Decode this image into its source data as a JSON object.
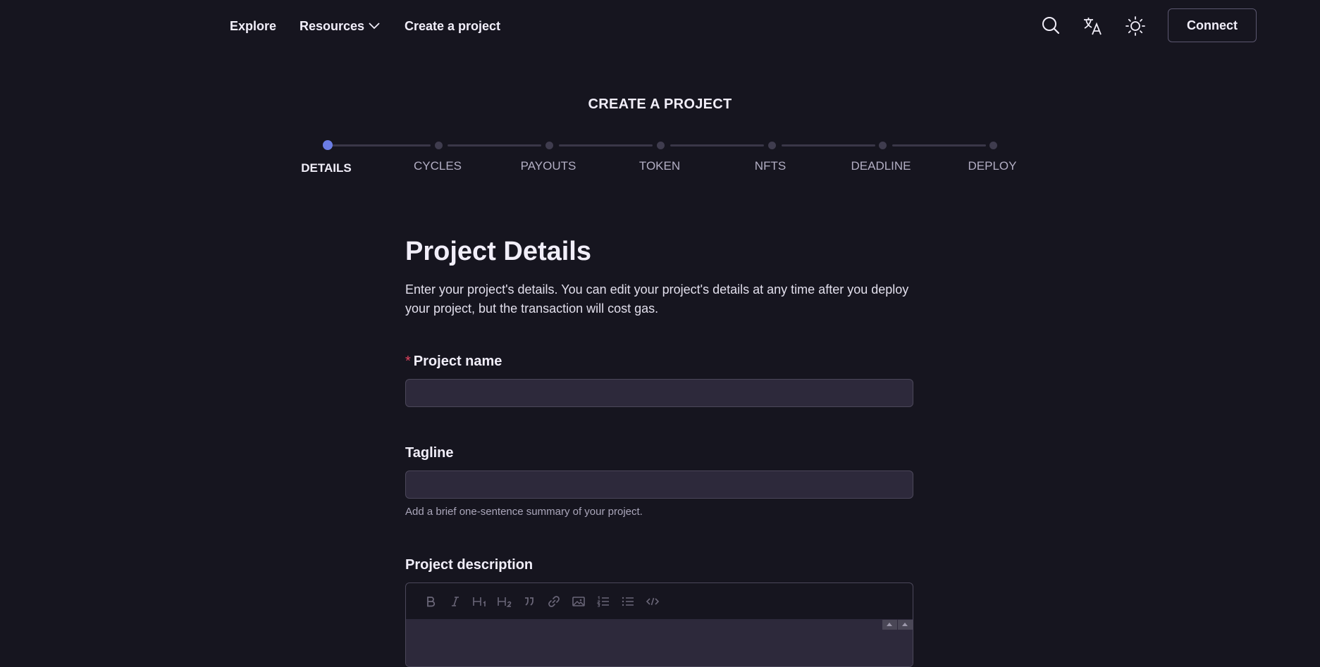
{
  "nav": {
    "explore": "Explore",
    "resources": "Resources",
    "create_project": "Create a project",
    "connect": "Connect",
    "icons": [
      "search-icon",
      "translate-icon",
      "sun-icon"
    ]
  },
  "page": {
    "heading": "CREATE A PROJECT"
  },
  "steps": [
    {
      "label": "DETAILS",
      "active": true
    },
    {
      "label": "CYCLES",
      "active": false
    },
    {
      "label": "PAYOUTS",
      "active": false
    },
    {
      "label": "TOKEN",
      "active": false
    },
    {
      "label": "NFTS",
      "active": false
    },
    {
      "label": "DEADLINE",
      "active": false
    },
    {
      "label": "DEPLOY",
      "active": false
    }
  ],
  "form": {
    "title": "Project Details",
    "description": "Enter your project's details. You can edit your project's details at any time after you deploy your project, but the transaction will cost gas.",
    "project_name": {
      "required_mark": "*",
      "label": "Project name",
      "value": "",
      "placeholder": ""
    },
    "tagline": {
      "label": "Tagline",
      "value": "",
      "placeholder": "",
      "help": "Add a brief one-sentence summary of your project."
    },
    "project_description": {
      "label": "Project description",
      "toolbar": [
        "bold-icon",
        "italic-icon",
        "heading1-icon",
        "heading2-icon",
        "quote-icon",
        "link-icon",
        "image-icon",
        "ordered-list-icon",
        "unordered-list-icon",
        "code-icon"
      ]
    }
  },
  "colors": {
    "background": "#16151f",
    "accent": "#6b7de5",
    "required": "#e1435e",
    "input_bg": "#2d293b"
  }
}
